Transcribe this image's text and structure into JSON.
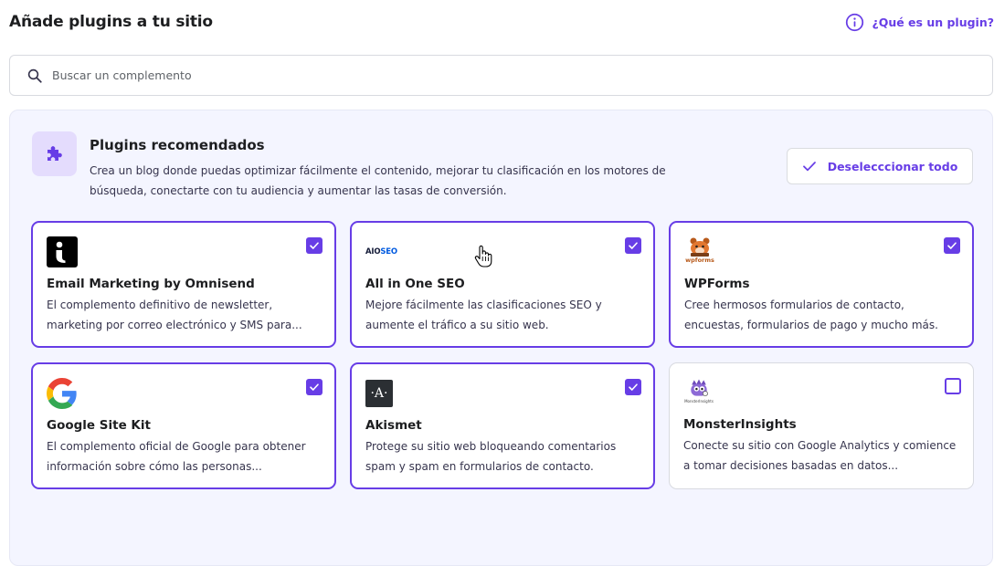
{
  "header": {
    "title": "Añade plugins a tu sitio",
    "help_link": "¿Qué es un plugin?"
  },
  "search": {
    "placeholder": "Buscar un complemento",
    "value": ""
  },
  "recommended": {
    "title": "Plugins recomendados",
    "description": "Crea un blog donde puedas optimizar fácilmente el contenido, mejorar tu clasificación en los motores de búsqueda, conectarte con tu audiencia y aumentar las tasas de conversión.",
    "deselect_label": "Deselecccionar todo"
  },
  "plugins": [
    {
      "name": "Email Marketing by Omnisend",
      "description": "El complemento definitivo de newsletter, marketing por correo electrónico y SMS para...",
      "selected": true,
      "icon": "omnisend-logo-icon"
    },
    {
      "name": "All in One SEO",
      "description": "Mejore fácilmente las clasificaciones SEO y aumente el tráfico a su sitio web.",
      "selected": true,
      "icon": "aioseo-logo-icon",
      "logo_text_a": "AIO",
      "logo_text_b": "SEO"
    },
    {
      "name": "WPForms",
      "description": "Cree hermosos formularios de contacto, encuestas, formularios de pago y mucho más.",
      "selected": true,
      "icon": "wpforms-logo-icon",
      "logo_text": "wpforms"
    },
    {
      "name": "Google Site Kit",
      "description": "El complemento oficial de Google para obtener información sobre cómo las personas...",
      "selected": true,
      "icon": "google-logo-icon"
    },
    {
      "name": "Akismet",
      "description": "Protege su sitio web bloqueando comentarios spam y spam en formularios de contacto.",
      "selected": true,
      "icon": "akismet-logo-icon",
      "logo_text": "·A·"
    },
    {
      "name": "MonsterInsights",
      "description": "Conecte su sitio con Google Analytics y comience a tomar decisiones basadas en datos...",
      "selected": false,
      "icon": "monsterinsights-logo-icon",
      "logo_text": "MonsterInsights"
    }
  ],
  "colors": {
    "accent": "#673de6",
    "panel_bg": "#f4f5ff",
    "text": "#1d1e20"
  }
}
